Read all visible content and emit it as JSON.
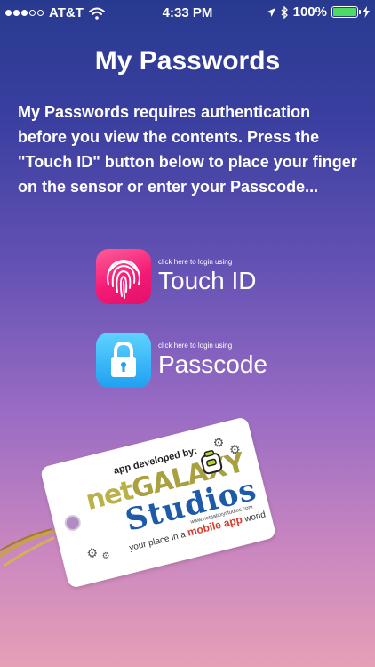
{
  "status_bar": {
    "carrier": "AT&T",
    "time": "4:33 PM",
    "battery": "100%",
    "battery_level": 1.0,
    "signal_bars_filled": 3,
    "signal_bars_total": 5,
    "icons": [
      "wifi-icon",
      "location-arrow-icon",
      "bluetooth-icon",
      "battery-icon",
      "charging-bolt-icon"
    ]
  },
  "header": {
    "title": "My Passwords"
  },
  "description": "My Passwords requires authentication before you view the contents. Press the \"Touch ID\" button below to place your finger on the sensor or enter your Passcode...",
  "login_options": {
    "touch_id": {
      "hint": "click here to login using",
      "label": "Touch ID",
      "icon": "fingerprint-icon",
      "color": "#f41b77"
    },
    "passcode": {
      "hint": "click here to login using",
      "label": "Passcode",
      "icon": "padlock-icon",
      "color": "#1fa1f0"
    }
  },
  "developer_tag": {
    "subtitle": "app developed by:",
    "brand_part1": "net",
    "brand_part2": "GALAXY",
    "brand_part3": "Studios",
    "slogan_before": "your place in a",
    "slogan_highlight": "mobile app",
    "slogan_after": "world",
    "url": "www.netgalaxystudios.com"
  }
}
